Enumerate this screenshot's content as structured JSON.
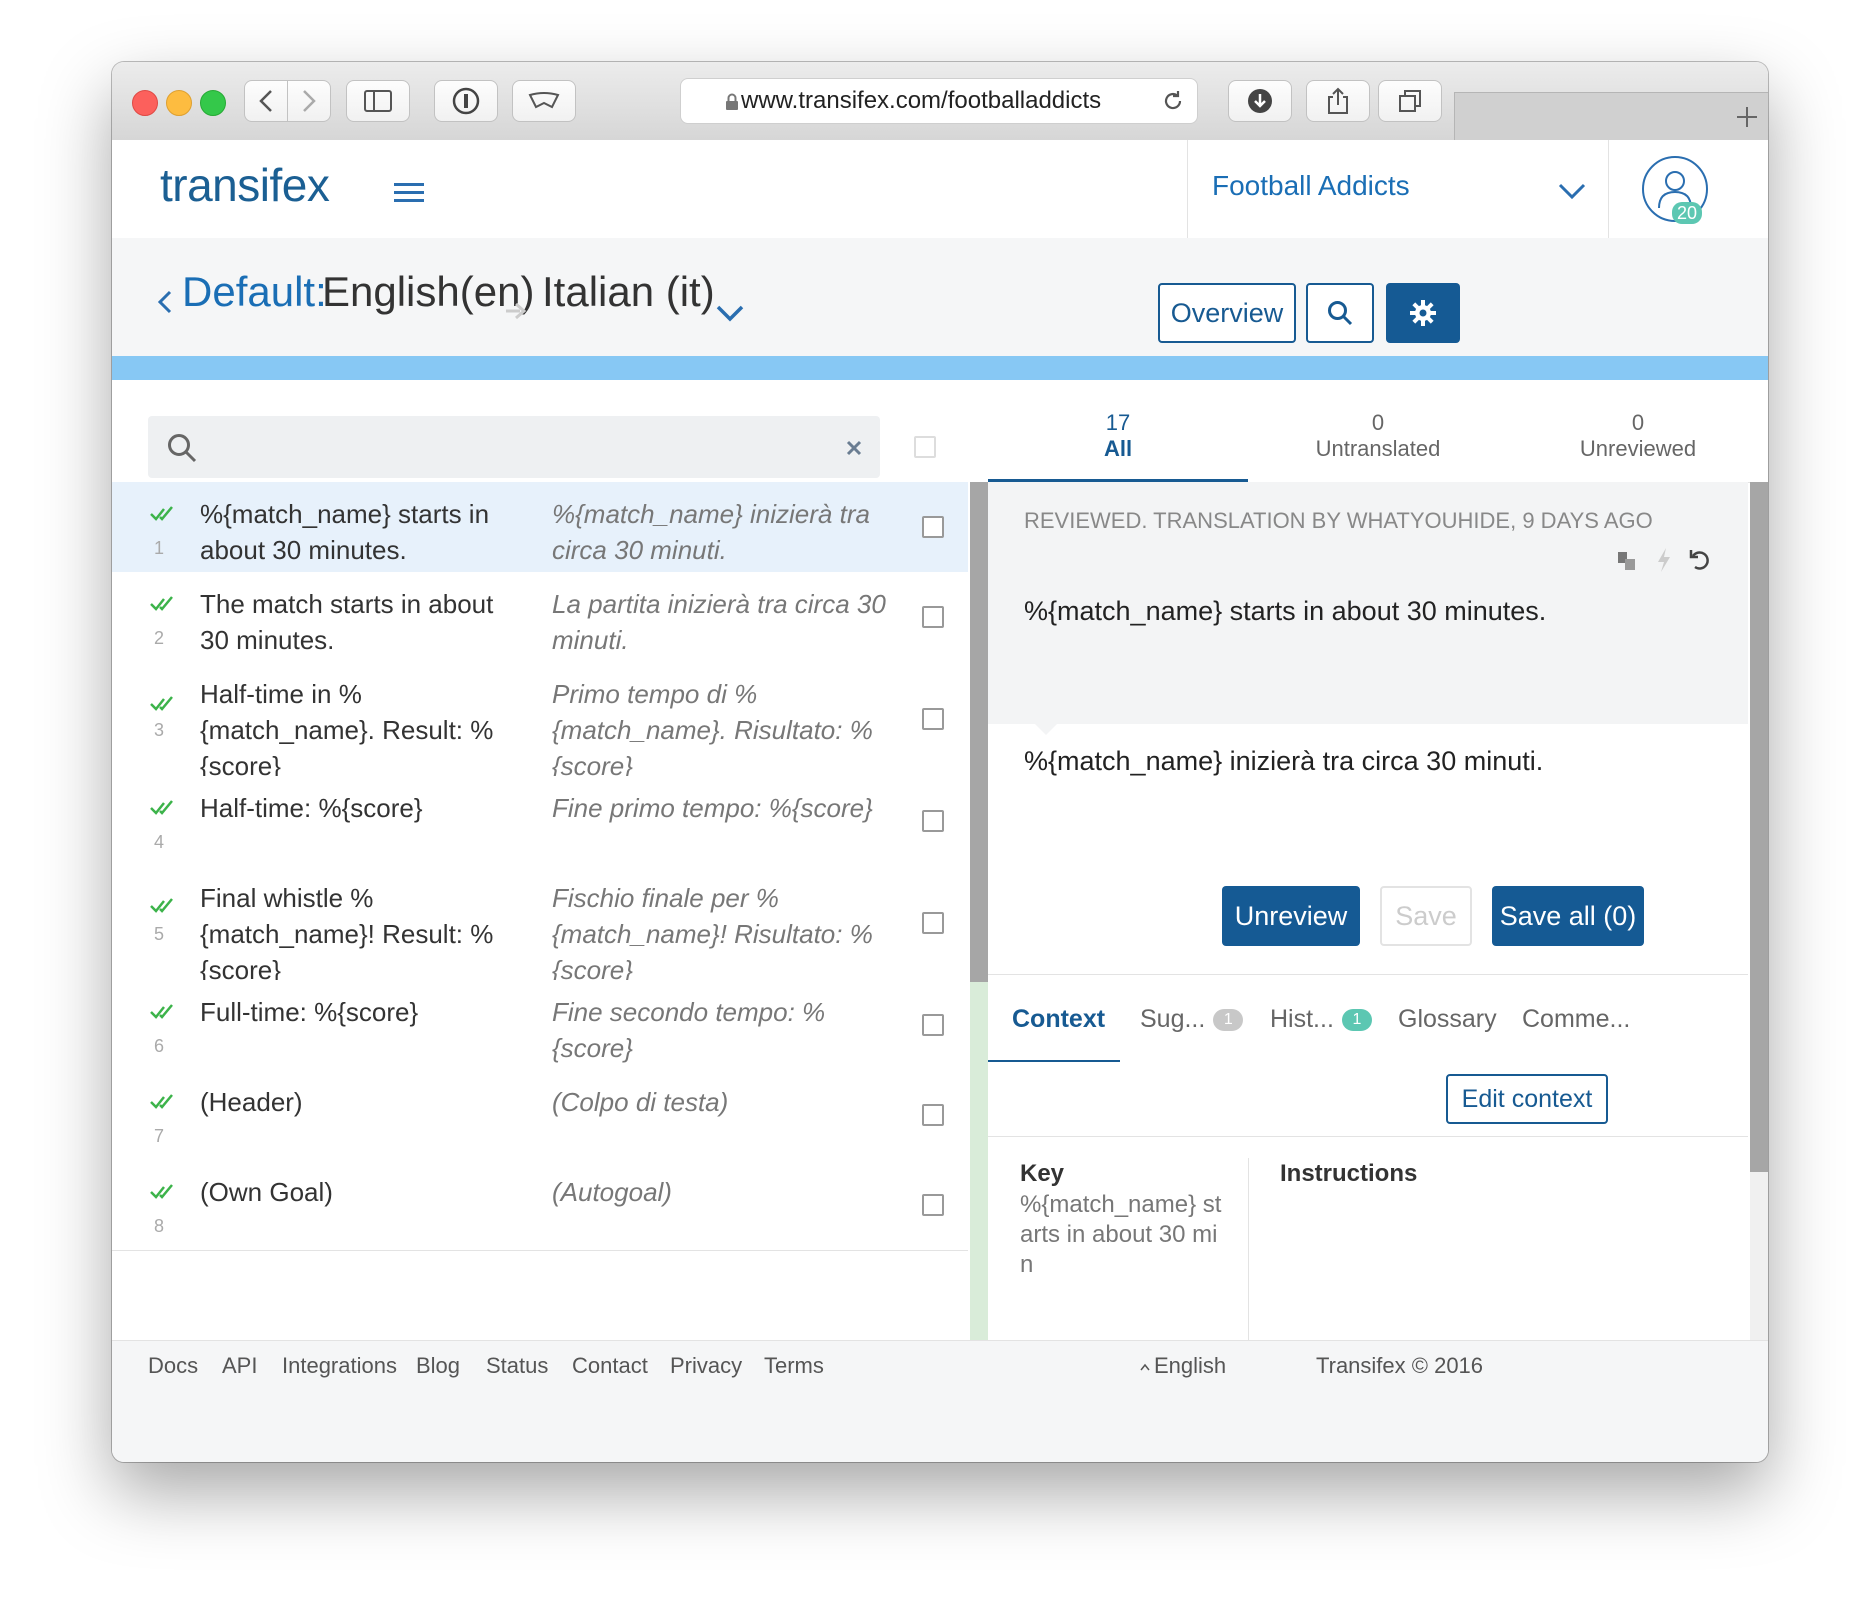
{
  "browser": {
    "url": "www.transifex.com/footballaddicts"
  },
  "app": {
    "logo": "transifex",
    "project": "Football Addicts",
    "avatar_badge": "20"
  },
  "breadcrumb": {
    "resource": "Default:",
    "source_lang": "English(en)",
    "target_lang": "Italian (it)"
  },
  "actions": {
    "overview": "Overview"
  },
  "filters": {
    "all_count": "17",
    "all_label": "All",
    "untranslated_count": "0",
    "untranslated_label": "Untranslated",
    "unreviewed_count": "0",
    "unreviewed_label": "Unreviewed"
  },
  "strings": [
    {
      "num": "1",
      "source": "%{match_name} starts in about 30 minutes.",
      "translation": "%{match_name} inizierà tra circa 30 minuti."
    },
    {
      "num": "2",
      "source": "The match starts in about 30 minutes.",
      "translation": "La partita inizierà tra circa 30 minuti."
    },
    {
      "num": "3",
      "source": "Half-time in %{match_name}. Result: %{score}",
      "translation": "Primo tempo di %{match_name}. Risultato: %{score}"
    },
    {
      "num": "4",
      "source": "Half-time: %{score}",
      "translation": "Fine primo tempo: %{score}"
    },
    {
      "num": "5",
      "source": "Final whistle %{match_name}! Result: %{score}",
      "translation": "Fischio finale per %{match_name}! Risultato: %{score}"
    },
    {
      "num": "6",
      "source": "Full-time: %{score}",
      "translation": "Fine secondo tempo: %{score}"
    },
    {
      "num": "7",
      "source": "(Header)",
      "translation": "(Colpo di testa)"
    },
    {
      "num": "8",
      "source": "(Own Goal)",
      "translation": "(Autogoal)"
    }
  ],
  "editor": {
    "status": "REVIEWED. TRANSLATION BY WHATYOUHIDE, 9 DAYS AGO",
    "source_text": "%{match_name} starts in about 30 minutes.",
    "translation_text": "%{match_name} inizierà tra circa 30 minuti.",
    "unreview": "Unreview",
    "save": "Save",
    "save_all": "Save all (0)"
  },
  "bottom_tabs": {
    "context": "Context",
    "suggestions": "Sug...",
    "suggestions_count": "1",
    "history": "Hist...",
    "history_count": "1",
    "glossary": "Glossary",
    "comments": "Comme..."
  },
  "context": {
    "edit": "Edit context",
    "key_label": "Key",
    "key_value": "%{match_name} starts in about 30 min",
    "instructions_label": "Instructions"
  },
  "footer": {
    "docs": "Docs",
    "api": "API",
    "integrations": "Integrations",
    "blog": "Blog",
    "status": "Status",
    "contact": "Contact",
    "privacy": "Privacy",
    "terms": "Terms",
    "language": "English",
    "copyright": "Transifex © 2016"
  },
  "colors": {
    "brand": "#1b5f93",
    "accent": "#155a94",
    "progress": "#87c8f4",
    "check": "#3cb34a",
    "teal_badge": "#5cc7b2"
  }
}
